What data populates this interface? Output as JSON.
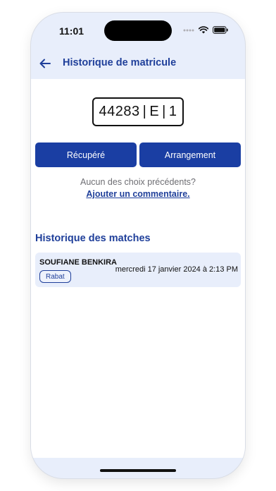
{
  "status": {
    "time": "11:01"
  },
  "header": {
    "title": "Historique de matricule"
  },
  "plate": {
    "part1": "44283",
    "part2": "E",
    "part3": "1",
    "separator": "|"
  },
  "actions": {
    "left_label": "Récupéré",
    "right_label": "Arrangement"
  },
  "prompt": {
    "question": "Aucun des choix précédents?",
    "link": "Ajouter un commentaire."
  },
  "history": {
    "title": "Historique des matches",
    "items": [
      {
        "name": "SOUFIANE BENKIRA",
        "date": "mercredi 17 janvier 2024 à 2:13 PM",
        "tag": "Rabat"
      }
    ]
  },
  "colors": {
    "primary": "#1a3ea3",
    "title": "#1f3f9a",
    "surface": "#e8eefb"
  }
}
